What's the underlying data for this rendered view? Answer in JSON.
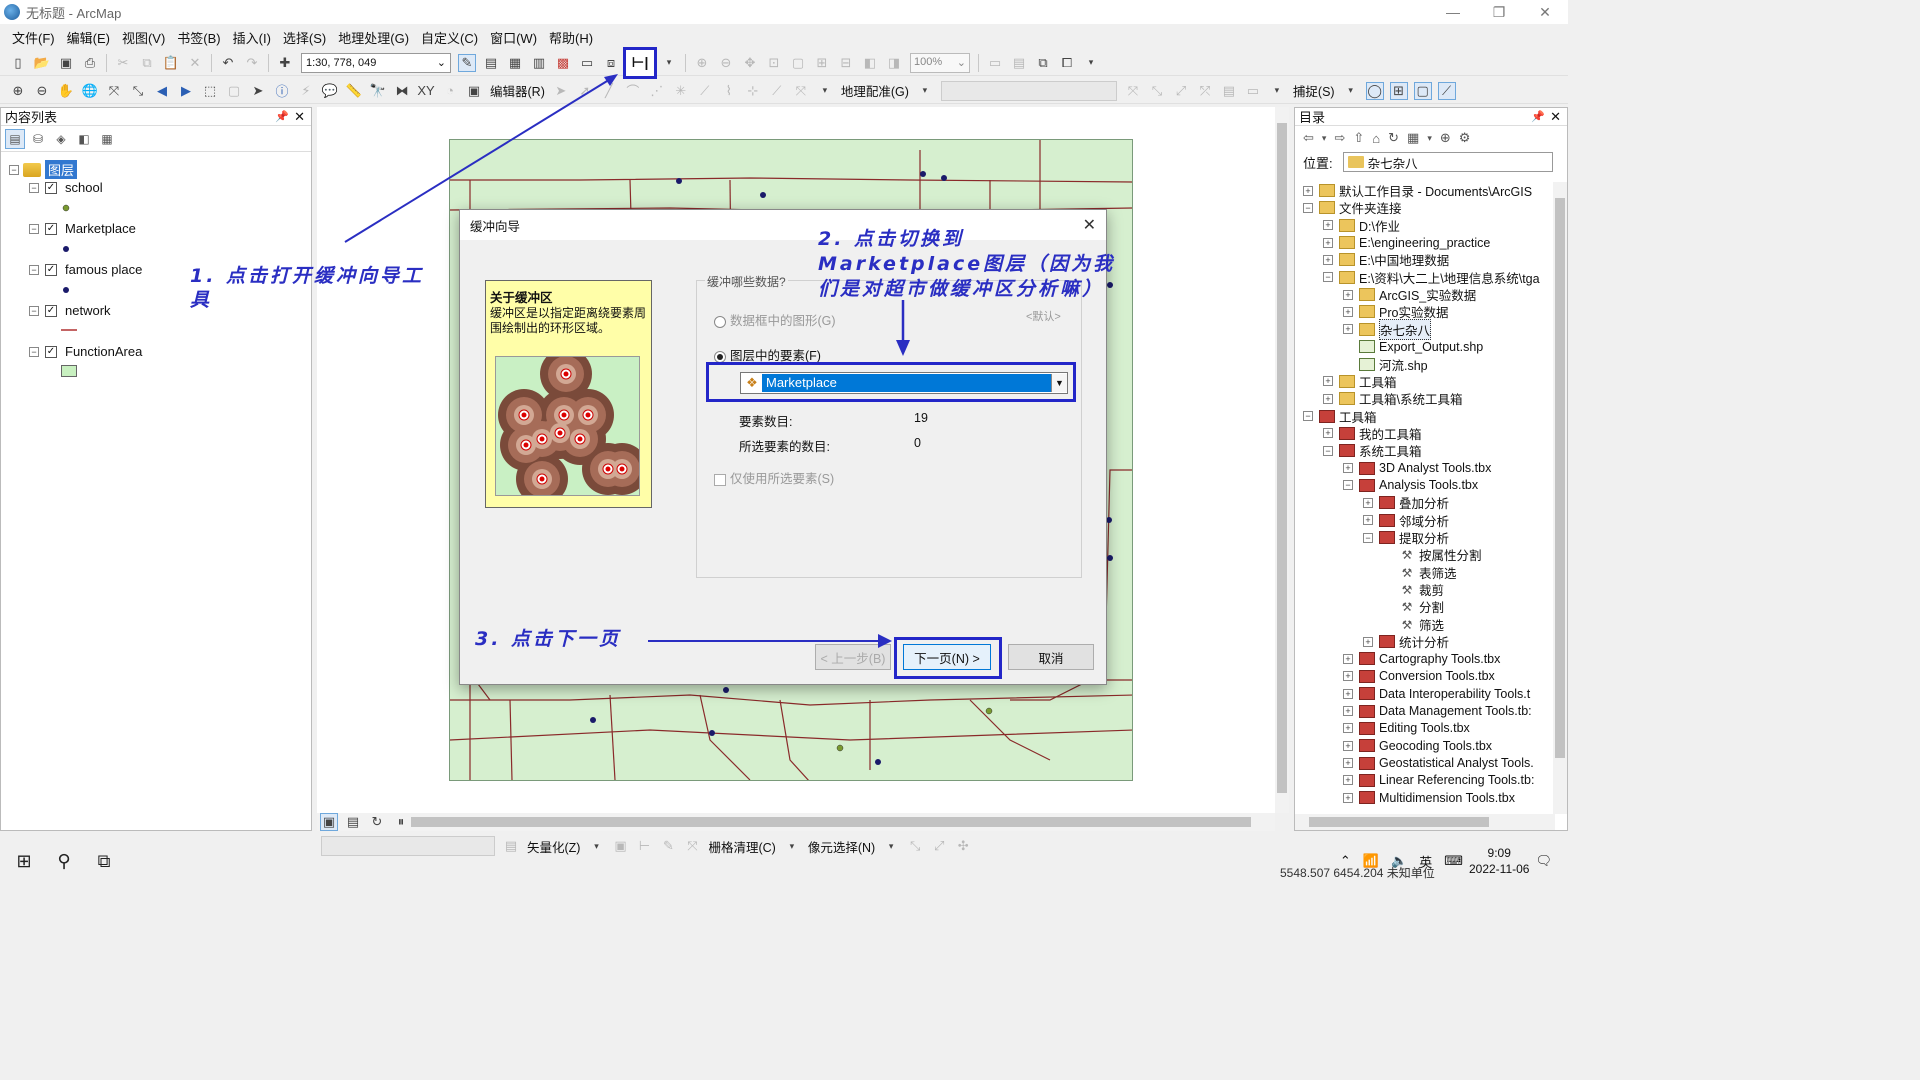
{
  "window": {
    "title": "无标题 - ArcMap",
    "minimize": "—",
    "maximize": "❐",
    "close": "✕"
  },
  "menu": [
    "文件(F)",
    "编辑(E)",
    "视图(V)",
    "书签(B)",
    "插入(I)",
    "选择(S)",
    "地理处理(G)",
    "自定义(C)",
    "窗口(W)",
    "帮助(H)"
  ],
  "toolbar1": {
    "scale": "1:30, 778, 049",
    "zoom": "100%"
  },
  "toolbar2": {
    "editor_label": "编辑器(R)",
    "georef_label": "地理配准(G)",
    "snap_label": "捕捉(S)"
  },
  "toc": {
    "title": "内容列表",
    "root_label": "图层",
    "layers": [
      {
        "name": "school",
        "color": "#7a9a30"
      },
      {
        "name": "Marketplace",
        "color": "#1a1a6a"
      },
      {
        "name": "famous place",
        "color": "#1a1a6a"
      },
      {
        "name": "network",
        "color": "#b03030"
      },
      {
        "name": "FunctionArea",
        "color": "#c8f0c0"
      }
    ]
  },
  "dialog": {
    "title": "缓冲向导",
    "about_title": "关于缓冲区",
    "about_desc": "缓冲区是以指定距离绕要素周围绘制出的环形区域。",
    "group_label": "缓冲哪些数据?",
    "option_frame": "数据框中的图形(G)",
    "default_label": "<默认>",
    "option_layer": "图层中的要素(F)",
    "selected_layer": "Marketplace",
    "feature_count_label": "要素数目:",
    "feature_count": "19",
    "selected_count_label": "所选要素的数目:",
    "selected_count": "0",
    "only_selected": "仅使用所选要素(S)",
    "back_button": "< 上一步(B)",
    "next_button": "下一页(N) >",
    "cancel_button": "取消"
  },
  "catalog": {
    "title": "目录",
    "location_label": "位置:",
    "location_value": "杂七杂八",
    "items": [
      {
        "label": "默认工作目录 - Documents\\ArcGIS",
        "depth": 0,
        "exp": "+",
        "icon": "folder"
      },
      {
        "label": "文件夹连接",
        "depth": 0,
        "exp": "−",
        "icon": "folder"
      },
      {
        "label": "D:\\作业",
        "depth": 1,
        "exp": "+",
        "icon": "folder"
      },
      {
        "label": "E:\\engineering_practice",
        "depth": 1,
        "exp": "+",
        "icon": "folder"
      },
      {
        "label": "E:\\中国地理数据",
        "depth": 1,
        "exp": "+",
        "icon": "folder"
      },
      {
        "label": "E:\\资料\\大二上\\地理信息系统\\tga",
        "depth": 1,
        "exp": "−",
        "icon": "folder"
      },
      {
        "label": "ArcGIS_实验数据",
        "depth": 2,
        "exp": "+",
        "icon": "folder"
      },
      {
        "label": "Pro实验数据",
        "depth": 2,
        "exp": "+",
        "icon": "folder"
      },
      {
        "label": "杂七杂八",
        "depth": 2,
        "exp": "+",
        "icon": "folder"
      },
      {
        "label": "Export_Output.shp",
        "depth": 2,
        "exp": "",
        "icon": "shp"
      },
      {
        "label": "河流.shp",
        "depth": 2,
        "exp": "",
        "icon": "shp"
      },
      {
        "label": "工具箱",
        "depth": 1,
        "exp": "+",
        "icon": "folder"
      },
      {
        "label": "工具箱\\系统工具箱",
        "depth": 1,
        "exp": "+",
        "icon": "folder"
      },
      {
        "label": "工具箱",
        "depth": 0,
        "exp": "−",
        "icon": "toolbox"
      },
      {
        "label": "我的工具箱",
        "depth": 1,
        "exp": "+",
        "icon": "toolbox"
      },
      {
        "label": "系统工具箱",
        "depth": 1,
        "exp": "−",
        "icon": "toolbox"
      },
      {
        "label": "3D Analyst Tools.tbx",
        "depth": 2,
        "exp": "+",
        "icon": "toolbox"
      },
      {
        "label": "Analysis Tools.tbx",
        "depth": 2,
        "exp": "−",
        "icon": "toolbox"
      },
      {
        "label": "叠加分析",
        "depth": 3,
        "exp": "+",
        "icon": "toolbox"
      },
      {
        "label": "邻域分析",
        "depth": 3,
        "exp": "+",
        "icon": "toolbox"
      },
      {
        "label": "提取分析",
        "depth": 3,
        "exp": "−",
        "icon": "toolbox"
      },
      {
        "label": "按属性分割",
        "depth": 4,
        "exp": "",
        "icon": "tool"
      },
      {
        "label": "表筛选",
        "depth": 4,
        "exp": "",
        "icon": "tool"
      },
      {
        "label": "裁剪",
        "depth": 4,
        "exp": "",
        "icon": "tool"
      },
      {
        "label": "分割",
        "depth": 4,
        "exp": "",
        "icon": "tool"
      },
      {
        "label": "筛选",
        "depth": 4,
        "exp": "",
        "icon": "tool"
      },
      {
        "label": "统计分析",
        "depth": 3,
        "exp": "+",
        "icon": "toolbox"
      },
      {
        "label": "Cartography Tools.tbx",
        "depth": 2,
        "exp": "+",
        "icon": "toolbox"
      },
      {
        "label": "Conversion Tools.tbx",
        "depth": 2,
        "exp": "+",
        "icon": "toolbox"
      },
      {
        "label": "Data Interoperability Tools.t",
        "depth": 2,
        "exp": "+",
        "icon": "toolbox"
      },
      {
        "label": "Data Management Tools.tb:",
        "depth": 2,
        "exp": "+",
        "icon": "toolbox"
      },
      {
        "label": "Editing Tools.tbx",
        "depth": 2,
        "exp": "+",
        "icon": "toolbox"
      },
      {
        "label": "Geocoding Tools.tbx",
        "depth": 2,
        "exp": "+",
        "icon": "toolbox"
      },
      {
        "label": "Geostatistical Analyst Tools.",
        "depth": 2,
        "exp": "+",
        "icon": "toolbox"
      },
      {
        "label": "Linear Referencing Tools.tb:",
        "depth": 2,
        "exp": "+",
        "icon": "toolbox"
      },
      {
        "label": "Multidimension Tools.tbx",
        "depth": 2,
        "exp": "+",
        "icon": "toolbox"
      }
    ]
  },
  "bottom_toolbar": {
    "vectorize": "矢量化(Z)",
    "raster_cleanup": "栅格清理(C)",
    "pixel_select": "像元选择(N)"
  },
  "status": {
    "coords": "5548.507  6454.204 未知单位"
  },
  "tray": {
    "ime": "英",
    "time": "9:09",
    "date": "2022-11-06"
  },
  "annotations": {
    "step1": "1. 点击打开缓冲向导工具",
    "step2": "2. 点击切换到Marketplace图层（因为我们是对超市做缓冲区分析嘛）",
    "step3": "3. 点击下一页"
  }
}
